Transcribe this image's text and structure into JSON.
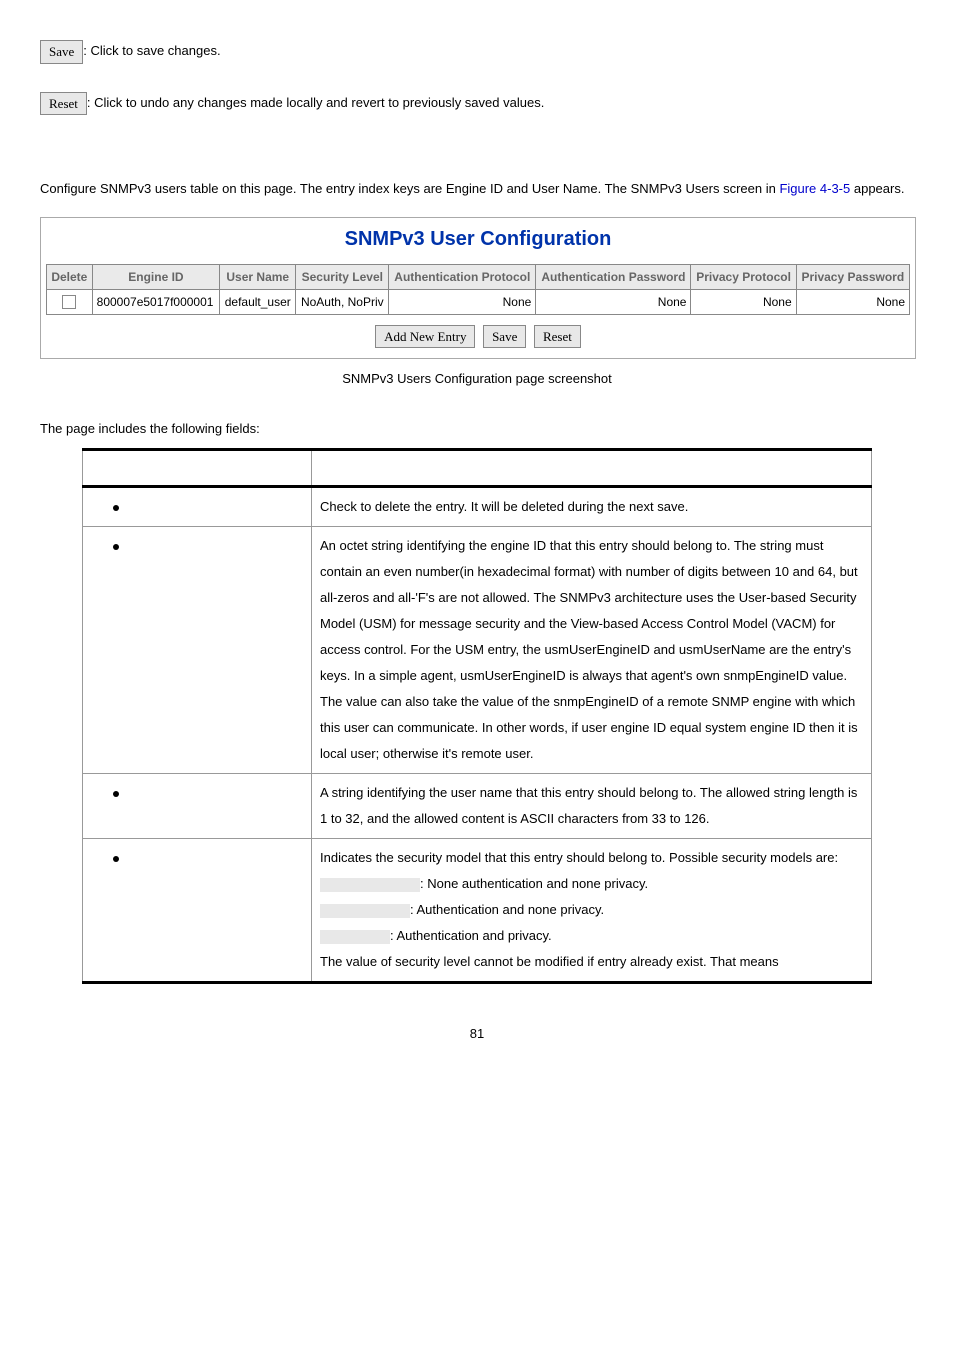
{
  "buttons": {
    "save": "Save",
    "reset": "Reset",
    "add_new_entry": "Add New Entry"
  },
  "save_desc": ": Click to save changes.",
  "reset_desc": ": Click to undo any changes made locally and revert to previously saved values.",
  "intro_text_1": "Configure SNMPv3 users table on this page. The entry index keys are Engine ID and User Name. The SNMPv3 Users screen in ",
  "figure_ref": "Figure 4-3-5",
  "intro_text_2": " appears.",
  "config_title": "SNMPv3 User Configuration",
  "headers": {
    "delete": "Delete",
    "engine_id": "Engine ID",
    "user_name": "User Name",
    "security_level": "Security Level",
    "auth_protocol": "Authentication Protocol",
    "auth_password": "Authentication Password",
    "priv_protocol": "Privacy Protocol",
    "priv_password": "Privacy Password"
  },
  "row": {
    "engine_id": "800007e5017f000001",
    "user_name": "default_user",
    "security_level": "NoAuth, NoPriv",
    "auth_protocol": "None",
    "auth_password": "None",
    "priv_protocol": "None",
    "priv_password": "None"
  },
  "caption": "SNMPv3 Users Configuration page screenshot",
  "fields_intro": "The page includes the following fields:",
  "fields": {
    "delete_desc": "Check to delete the entry. It will be deleted during the next save.",
    "engine_desc": "An octet string identifying the engine ID that this entry should belong to. The string must contain an even number(in hexadecimal format) with number of digits between 10 and 64, but all-zeros and all-'F's are not allowed. The SNMPv3 architecture uses the User-based Security Model (USM) for message security and the View-based Access Control Model (VACM) for access control. For the USM entry, the usmUserEngineID and usmUserName are the entry's keys. In a simple agent, usmUserEngineID is always that agent's own snmpEngineID value. The value can also take the value of the snmpEngineID of a remote SNMP engine with which this user can communicate. In other words, if user engine ID equal system engine ID then it is local user; otherwise it's remote user.",
    "username_desc": "A string identifying the user name that this entry should belong to. The allowed string length is 1 to 32, and the allowed content is ASCII characters from 33 to 126.",
    "seclevel_intro": "Indicates the security model that this entry should belong to. Possible security models are:",
    "seclevel_opt1": ": None authentication and none privacy.",
    "seclevel_opt2": ": Authentication and none privacy.",
    "seclevel_opt3": ": Authentication and privacy.",
    "seclevel_note": "The value of security level cannot be modified if entry already exist. That means"
  },
  "page_number": "81"
}
